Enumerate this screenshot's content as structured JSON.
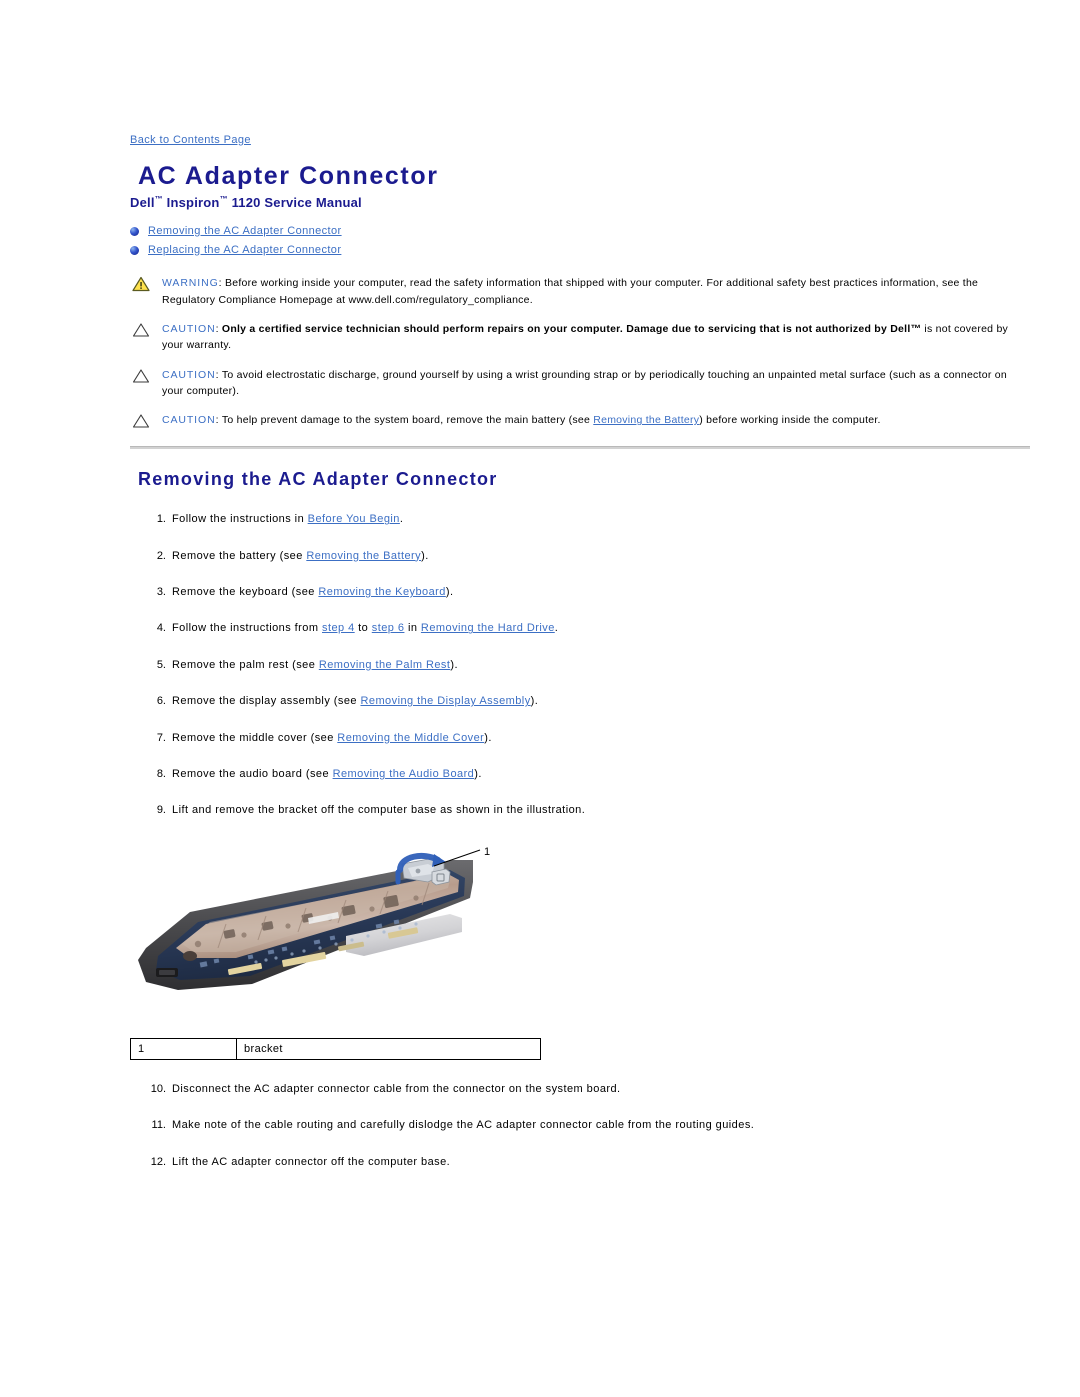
{
  "colors": {
    "title_blue": "#1b1b8f",
    "link_blue": "#3c6fc4",
    "warning_yellow": "#ffe24d",
    "rule_gray": "#d2d2d2"
  },
  "back_link": "Back to Contents Page",
  "header": {
    "title": "AC Adapter Connector",
    "subtitle_pre": "Dell",
    "subtitle_mid": " Inspiron",
    "subtitle_post": " 1120 Service Manual",
    "trademark": "™"
  },
  "toc": [
    {
      "label": "Removing the AC Adapter Connector"
    },
    {
      "label": "Replacing the AC Adapter Connector"
    }
  ],
  "notes": [
    {
      "icon": "warning-triangle-icon",
      "type": "warning",
      "label": "WARNING",
      "text": "Before working inside your computer, read the safety information that shipped with your computer. For additional safety best practices information, see the Regulatory Compliance Homepage at www.dell.com/regulatory_compliance.",
      "bold": false
    },
    {
      "icon": "caution-triangle-icon",
      "type": "caution",
      "label": "CAUTION",
      "text_bold": "Only a certified service technician should perform repairs on your computer. Damage due to servicing that is not authorized by Dell™",
      "text_rest": "is not covered by your warranty.",
      "bold": true
    },
    {
      "icon": "caution-triangle-icon",
      "type": "caution",
      "label": "CAUTION",
      "text": "To avoid electrostatic discharge, ground yourself by using a wrist grounding strap or by periodically touching an unpainted metal surface (such as a connector on your computer).",
      "bold": false
    },
    {
      "icon": "caution-triangle-icon",
      "type": "caution",
      "label": "CAUTION",
      "text_before": "To help prevent damage to the system board, remove the main battery (see ",
      "link": "Removing the Battery",
      "text_after": ") before working inside the computer.",
      "bold": false
    }
  ],
  "section": {
    "title": "Removing the AC Adapter Connector"
  },
  "steps": [
    {
      "num": "1.",
      "before": "Follow the instructions in ",
      "link": "Before You Begin",
      "after": "."
    },
    {
      "num": "2.",
      "before": "Remove the battery (see ",
      "link": "Removing the Battery",
      "after": ")."
    },
    {
      "num": "3.",
      "before": "Remove the keyboard (see ",
      "link": "Removing the Keyboard",
      "after": ")."
    },
    {
      "num": "4.",
      "before": "Follow the instructions from ",
      "link": "step 4",
      "mid": " to ",
      "link2": "step 6",
      "mid2": " in ",
      "link3": "Removing the Hard Drive",
      "after": "."
    },
    {
      "num": "5.",
      "before": "Remove the palm rest (see ",
      "link": "Removing the Palm Rest",
      "after": ")."
    },
    {
      "num": "6.",
      "before": "Remove the display assembly (see ",
      "link": "Removing the Display Assembly",
      "after": ")."
    },
    {
      "num": "7.",
      "before": "Remove the middle cover (see ",
      "link": "Removing the Middle Cover",
      "after": ")."
    },
    {
      "num": "8.",
      "before": "Remove the audio board (see ",
      "link": "Removing the Audio Board",
      "after": ")."
    },
    {
      "num": "9.",
      "before": "Lift and remove the bracket off the computer base as shown in the illustration.",
      "link": "",
      "after": ""
    }
  ],
  "figure": {
    "alt": "Laptop computer base with system board showing bracket being lifted",
    "callout_number": "1"
  },
  "legend": {
    "rows": [
      {
        "number": "1",
        "name": "bracket"
      }
    ]
  },
  "trailing_steps": [
    {
      "num": "10.",
      "text": "Disconnect the AC adapter connector cable from the connector on the system board."
    },
    {
      "num": "11.",
      "text": "Make note of the cable routing and carefully dislodge the AC adapter connector cable from the routing guides."
    },
    {
      "num": "12.",
      "text": "Lift the AC adapter connector off the computer base."
    }
  ]
}
